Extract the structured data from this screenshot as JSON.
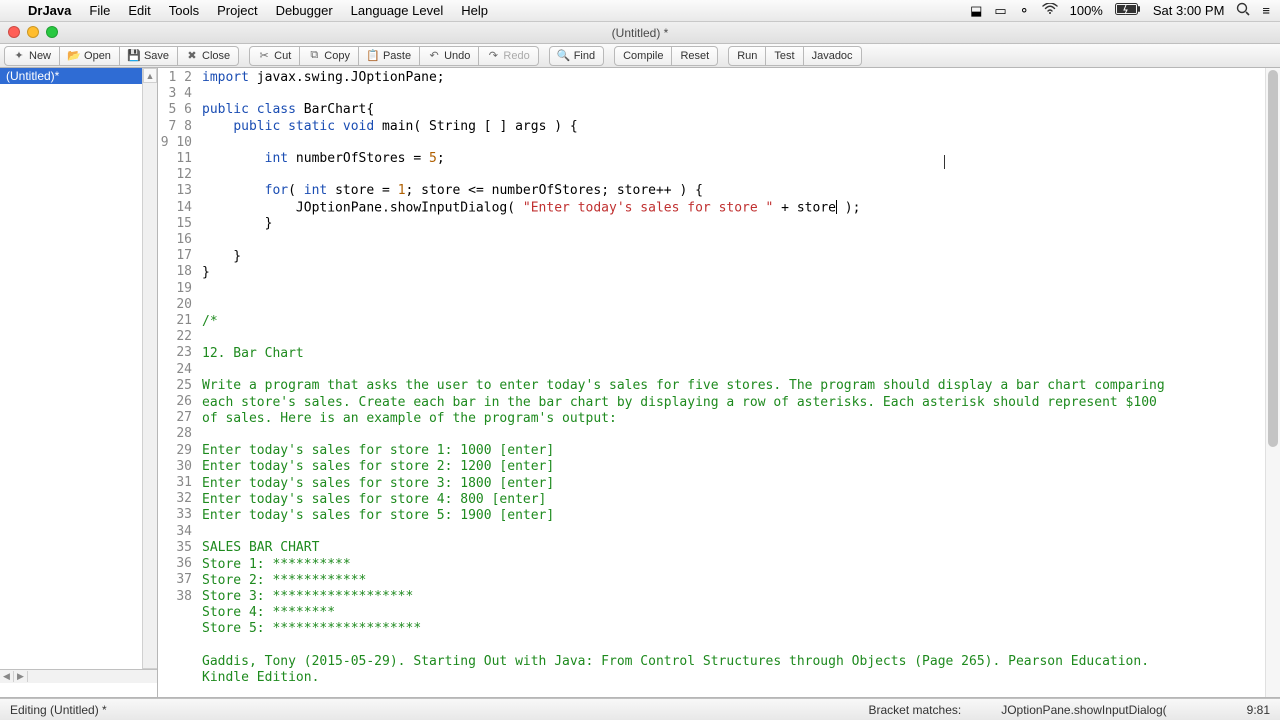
{
  "menubar": {
    "app": "DrJava",
    "items": [
      "File",
      "Edit",
      "Tools",
      "Project",
      "Debugger",
      "Language Level",
      "Help"
    ],
    "battery": "100%",
    "clock": "Sat 3:00 PM"
  },
  "window": {
    "title": "(Untitled) *",
    "traffic": [
      "close",
      "minimize",
      "zoom"
    ]
  },
  "toolbar": {
    "new": "New",
    "open": "Open",
    "save": "Save",
    "close": "Close",
    "cut": "Cut",
    "copy": "Copy",
    "paste": "Paste",
    "undo": "Undo",
    "redo": "Redo",
    "find": "Find",
    "compile": "Compile",
    "reset": "Reset",
    "run": "Run",
    "test": "Test",
    "javadoc": "Javadoc"
  },
  "sidebar": {
    "file": "(Untitled)*"
  },
  "editor": {
    "first_line": 1,
    "last_line": 38,
    "lines": [
      {
        "t": "code",
        "seg": [
          [
            "kw",
            "import"
          ],
          [
            "",
            " javax.swing.JOptionPane;"
          ]
        ]
      },
      {
        "t": "blank"
      },
      {
        "t": "code",
        "seg": [
          [
            "kw",
            "public"
          ],
          [
            "",
            " "
          ],
          [
            "kw",
            "class"
          ],
          [
            "",
            " BarChart{"
          ]
        ]
      },
      {
        "t": "code",
        "seg": [
          [
            "",
            "    "
          ],
          [
            "kw",
            "public"
          ],
          [
            "",
            " "
          ],
          [
            "kw",
            "static"
          ],
          [
            "",
            " "
          ],
          [
            "type",
            "void"
          ],
          [
            "",
            " main( String [ ] args ) {"
          ]
        ]
      },
      {
        "t": "blank"
      },
      {
        "t": "code",
        "seg": [
          [
            "",
            "        "
          ],
          [
            "type",
            "int"
          ],
          [
            "",
            " numberOfStores = "
          ],
          [
            "num",
            "5"
          ],
          [
            "",
            ";"
          ]
        ]
      },
      {
        "t": "blank"
      },
      {
        "t": "code",
        "seg": [
          [
            "",
            "        "
          ],
          [
            "kw",
            "for"
          ],
          [
            "",
            "( "
          ],
          [
            "type",
            "int"
          ],
          [
            "",
            " store = "
          ],
          [
            "num",
            "1"
          ],
          [
            "",
            "; store <= numberOfStores; store++ ) {"
          ]
        ]
      },
      {
        "t": "code",
        "seg": [
          [
            "",
            "            JOptionPane.showInputDialog( "
          ],
          [
            "str",
            "\"Enter today's sales for store \""
          ],
          [
            "",
            " + store"
          ],
          [
            "caret",
            ""
          ],
          [
            "",
            " );"
          ]
        ]
      },
      {
        "t": "code",
        "seg": [
          [
            "",
            "        }"
          ]
        ]
      },
      {
        "t": "blank"
      },
      {
        "t": "code",
        "seg": [
          [
            "",
            "    }"
          ]
        ]
      },
      {
        "t": "code",
        "seg": [
          [
            "",
            "}"
          ]
        ]
      },
      {
        "t": "blank"
      },
      {
        "t": "blank"
      },
      {
        "t": "cm",
        "text": "/*"
      },
      {
        "t": "blank"
      },
      {
        "t": "cm",
        "text": "12. Bar Chart"
      },
      {
        "t": "blank"
      },
      {
        "t": "cm",
        "text": "Write a program that asks the user to enter today's sales for five stores. The program should display a bar chart comparing"
      },
      {
        "t": "cm",
        "text": "each store's sales. Create each bar in the bar chart by displaying a row of asterisks. Each asterisk should represent $100"
      },
      {
        "t": "cm",
        "text": "of sales. Here is an example of the program's output:"
      },
      {
        "t": "blank"
      },
      {
        "t": "cm",
        "text": "Enter today's sales for store 1: 1000 [enter]"
      },
      {
        "t": "cm",
        "text": "Enter today's sales for store 2: 1200 [enter]"
      },
      {
        "t": "cm",
        "text": "Enter today's sales for store 3: 1800 [enter]"
      },
      {
        "t": "cm",
        "text": "Enter today's sales for store 4: 800 [enter]"
      },
      {
        "t": "cm",
        "text": "Enter today's sales for store 5: 1900 [enter]"
      },
      {
        "t": "blank"
      },
      {
        "t": "cm",
        "text": "SALES BAR CHART"
      },
      {
        "t": "cm",
        "text": "Store 1: **********"
      },
      {
        "t": "cm",
        "text": "Store 2: ************"
      },
      {
        "t": "cm",
        "text": "Store 3: ******************"
      },
      {
        "t": "cm",
        "text": "Store 4: ********"
      },
      {
        "t": "cm",
        "text": "Store 5: *******************"
      },
      {
        "t": "blank"
      },
      {
        "t": "cm",
        "text": "Gaddis, Tony (2015-05-29). Starting Out with Java: From Control Structures through Objects (Page 265). Pearson Education."
      },
      {
        "t": "cm",
        "text": "Kindle Edition."
      }
    ]
  },
  "status": {
    "left": "Editing (Untitled) *",
    "bracket_label": "Bracket matches:",
    "bracket_value": "JOptionPane.showInputDialog(",
    "pos": "9:81"
  }
}
